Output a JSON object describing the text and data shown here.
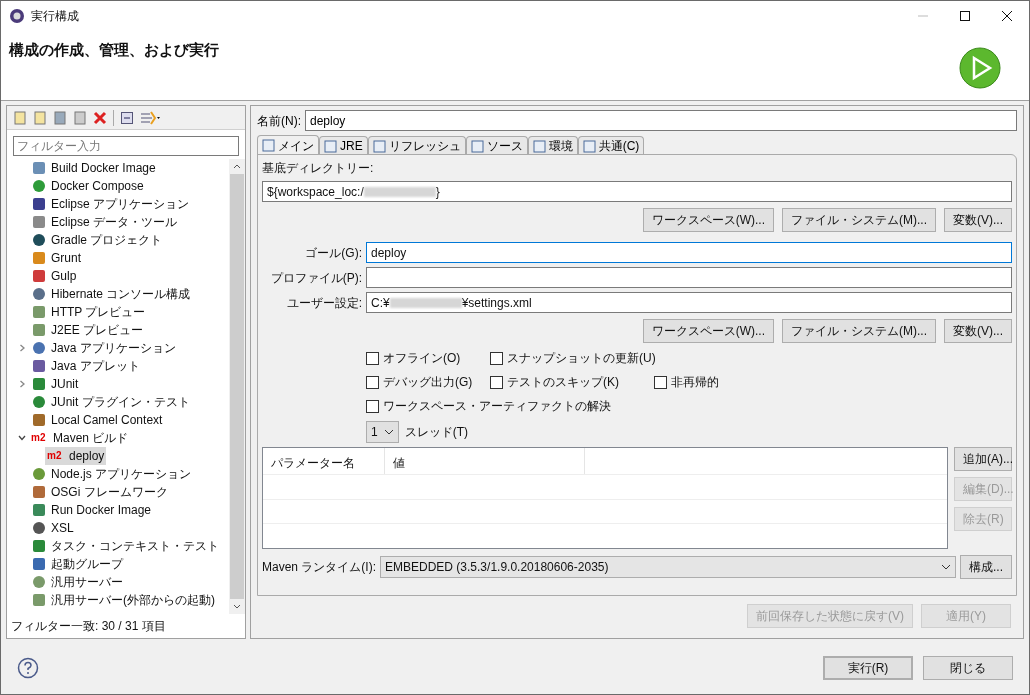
{
  "window": {
    "title": "実行構成"
  },
  "header": {
    "title": "構成の作成、管理、および実行"
  },
  "sidebar": {
    "filter": {
      "placeholder": "フィルター入力"
    },
    "items": [
      {
        "label": "Build Docker Image",
        "selected": false
      },
      {
        "label": "Docker Compose",
        "selected": false
      },
      {
        "label": "Eclipse アプリケーション",
        "selected": false
      },
      {
        "label": "Eclipse データ・ツール",
        "selected": false
      },
      {
        "label": "Gradle プロジェクト",
        "selected": false
      },
      {
        "label": "Grunt",
        "selected": false
      },
      {
        "label": "Gulp",
        "selected": false
      },
      {
        "label": "Hibernate コンソール構成",
        "selected": false
      },
      {
        "label": "HTTP プレビュー",
        "selected": false
      },
      {
        "label": "J2EE プレビュー",
        "selected": false
      },
      {
        "label": "Java アプリケーション",
        "selected": false,
        "expanded": false
      },
      {
        "label": "Java アプレット",
        "selected": false
      },
      {
        "label": "JUnit",
        "selected": false,
        "expanded": false
      },
      {
        "label": "JUnit プラグイン・テスト",
        "selected": false
      },
      {
        "label": "Local Camel Context",
        "selected": false
      },
      {
        "label": "Maven ビルド",
        "selected": false,
        "expanded": true,
        "badge": "m2",
        "children": [
          {
            "label": "deploy",
            "selected": true,
            "badge": "m2"
          }
        ]
      },
      {
        "label": "Node.js アプリケーション",
        "selected": false
      },
      {
        "label": "OSGi フレームワーク",
        "selected": false
      },
      {
        "label": "Run Docker Image",
        "selected": false
      },
      {
        "label": "XSL",
        "selected": false
      },
      {
        "label": "タスク・コンテキスト・テスト",
        "selected": false
      },
      {
        "label": "起動グループ",
        "selected": false
      },
      {
        "label": "汎用サーバー",
        "selected": false
      },
      {
        "label": "汎用サーバー(外部からの起動)",
        "selected": false
      }
    ],
    "status": "フィルター一致: 30 / 31 項目"
  },
  "name_field": {
    "label": "名前(N):",
    "value": "deploy"
  },
  "tabs": [
    {
      "label": "メイン",
      "selected": true
    },
    {
      "label": "JRE",
      "selected": false
    },
    {
      "label": "リフレッシュ",
      "selected": false
    },
    {
      "label": "ソース",
      "selected": false
    },
    {
      "label": "環境",
      "selected": false
    },
    {
      "label": "共通(C)",
      "selected": false
    }
  ],
  "base_dir": {
    "label": "基底ディレクトリー:",
    "value_start": "${workspace_loc:/",
    "value_end": "}"
  },
  "browse_buttons_1": [
    "ワークスペース(W)...",
    "ファイル・システム(M)...",
    "変数(V)..."
  ],
  "goal": {
    "label": "ゴール(G):",
    "value": "deploy",
    "focused": true
  },
  "profile": {
    "label": "プロファイル(P):"
  },
  "user_settings": {
    "label": "ユーザー設定:",
    "value_start": "C:¥",
    "value_end": "¥settings.xml"
  },
  "browse_buttons_2": [
    "ワークスペース(W)...",
    "ファイル・システム(M)...",
    "変数(V)..."
  ],
  "options": [
    [
      {
        "label": "オフライン(O)",
        "checked": false
      },
      {
        "label": "スナップショットの更新(U)",
        "checked": false
      }
    ],
    [
      {
        "label": "デバッグ出力(G)",
        "checked": false
      },
      {
        "label": "テストのスキップ(K)",
        "checked": false
      },
      {
        "label": "非再帰的",
        "checked": false
      }
    ],
    [
      {
        "label": "ワークスペース・アーティファクトの解決",
        "checked": false
      }
    ]
  ],
  "threads": {
    "value": "1",
    "label": "スレッド(T)"
  },
  "parameters": {
    "columns": [
      "パラメーター名",
      "値"
    ],
    "buttons": [
      {
        "label": "追加(A)...",
        "disabled": false
      },
      {
        "label": "編集(D)...",
        "disabled": true
      },
      {
        "label": "除去(R)",
        "disabled": true
      }
    ]
  },
  "runtime": {
    "label": "Maven ランタイム(I):",
    "value": "EMBEDDED (3.5.3/1.9.0.20180606-2035)",
    "button": "構成..."
  },
  "panel_buttons": [
    {
      "label": "前回保存した状態に戻す(V)",
      "disabled": true
    },
    {
      "label": "適用(Y)",
      "disabled": true
    }
  ],
  "footer": {
    "buttons": [
      {
        "label": "実行(R)",
        "default": true
      },
      {
        "label": "閉じる",
        "default": false
      }
    ]
  }
}
